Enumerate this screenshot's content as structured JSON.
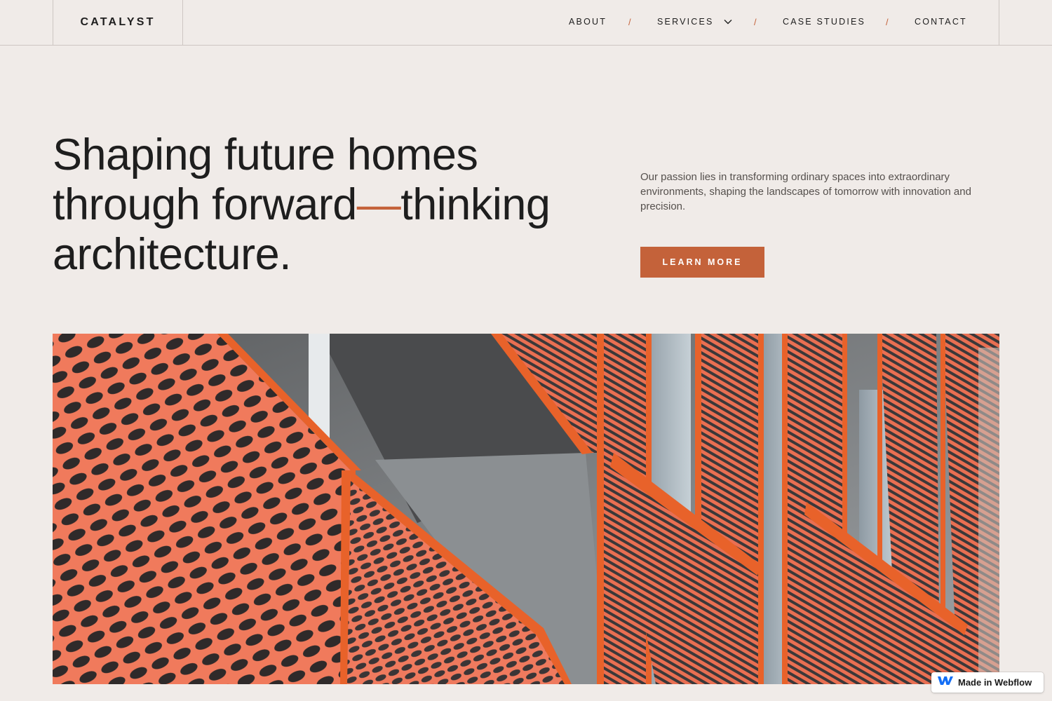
{
  "header": {
    "logo": "CATALYST",
    "nav": {
      "about": "ABOUT",
      "services": "SERVICES",
      "case_studies": "CASE STUDIES",
      "contact": "CONTACT",
      "separator": "/"
    }
  },
  "hero": {
    "headline_part1": "Shaping future homes through forward",
    "headline_dash": "—",
    "headline_part2": "thinking architecture.",
    "intro": "Our passion lies in transforming ordinary spaces into extraordinary environments, shaping the landscapes of tomorrow with innovation and precision.",
    "cta_label": "LEARN MORE"
  },
  "badge": {
    "label": "Made in Webflow",
    "icon": "webflow-logo-icon"
  },
  "colors": {
    "background": "#f0ebe8",
    "accent": "#c4623a",
    "text": "#1e1e1e",
    "panel_orange": "#e8622a"
  }
}
